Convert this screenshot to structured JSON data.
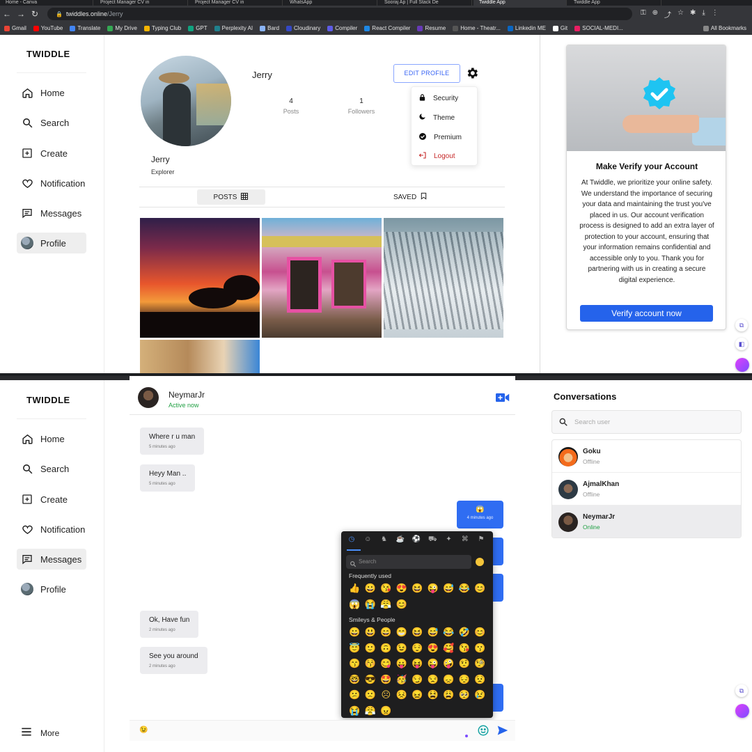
{
  "browser": {
    "tabs": [
      "Home - Canva",
      "Project Manager CV in",
      "Project Manager CV in",
      "WhatsApp",
      "Sooraj Ap | Full Stack De",
      "Twiddle App",
      "Twiddle App"
    ],
    "url_domain": "twiddles.online",
    "url_path": "/Jerry",
    "bookmarks": [
      "Gmail",
      "YouTube",
      "Translate",
      "My Drive",
      "Typing Club",
      "GPT",
      "Perplexity AI",
      "Bard",
      "Cloudinary",
      "Compiler",
      "React Compiler",
      "Resume",
      "Home - Theatr...",
      "Linkedin ME",
      "Git",
      "SOCIAL-MEDI..."
    ],
    "all_bookmarks": "All Bookmarks"
  },
  "app": {
    "brand": "TWIDDLE"
  },
  "nav": {
    "home": "Home",
    "search": "Search",
    "create": "Create",
    "notification": "Notification",
    "messages": "Messages",
    "profile": "Profile",
    "more": "More"
  },
  "profile": {
    "username": "Jerry",
    "posts_count": "4",
    "posts_label": "Posts",
    "followers_count": "1",
    "followers_label": "Followers",
    "edit_button": "EDIT PROFILE",
    "name": "Jerry",
    "bio": "Explorer",
    "tab_posts": "POSTS",
    "tab_saved": "SAVED"
  },
  "settings_menu": {
    "security": "Security",
    "theme": "Theme",
    "premium": "Premium",
    "logout": "Logout"
  },
  "verify": {
    "title": "Make Verify your Account",
    "body": "At Twiddle, we prioritize your online safety. We understand the importance of securing your data and maintaining the trust you've placed in us. Our account verification process is designed to add an extra layer of protection to your account, ensuring that your information remains confidential and accessible only to you. Thank you for partnering with us in creating a secure digital experience.",
    "button": "Verify account now"
  },
  "chat": {
    "name": "NeymarJr",
    "status": "Active now",
    "incoming": [
      {
        "text": "Where r u man",
        "time": "5 minutes ago"
      },
      {
        "text": "Heyy Man ..",
        "time": "5 minutes ago"
      },
      {
        "text": "Ok, Have fun",
        "time": "2 minutes ago"
      },
      {
        "text": "See you around",
        "time": "2 minutes ago"
      }
    ],
    "outgoing": [
      {
        "text": "😱",
        "time": "4 minutes ago"
      }
    ],
    "input_value": "😉"
  },
  "emoji_picker": {
    "search_placeholder": "Search",
    "frequently_used_label": "Frequently used",
    "frequently_used": [
      "👍",
      "😀",
      "😘",
      "😍",
      "😆",
      "😜",
      "😅",
      "😂",
      "😊",
      "😱",
      "😭",
      "😤",
      "😊"
    ],
    "smileys_label": "Smileys & People",
    "smileys": [
      "😀",
      "😃",
      "😄",
      "😁",
      "😆",
      "😅",
      "😂",
      "🤣",
      "😊",
      "😇",
      "🙂",
      "🙃",
      "😉",
      "😌",
      "😍",
      "🥰",
      "😘",
      "😗",
      "😙",
      "😚",
      "😋",
      "😛",
      "😝",
      "😜",
      "🤪",
      "🤨",
      "🧐",
      "🤓",
      "😎",
      "🤩",
      "🥳",
      "😏",
      "😒",
      "😞",
      "😔",
      "😟",
      "😕",
      "🙁",
      "☹",
      "😣",
      "😖",
      "😫",
      "😩",
      "🥺",
      "😢",
      "😭",
      "😤",
      "😠"
    ]
  },
  "conversations": {
    "title": "Conversations",
    "search_placeholder": "Search user",
    "items": [
      {
        "name": "Goku",
        "status": "Offline"
      },
      {
        "name": "AjmalKhan",
        "status": "Offline"
      },
      {
        "name": "NeymarJr",
        "status": "Online"
      }
    ]
  },
  "colors": {
    "accent": "#2563eb",
    "online": "#21a044",
    "logout": "#c62828",
    "emoji_panel": "#1e1e1f"
  }
}
